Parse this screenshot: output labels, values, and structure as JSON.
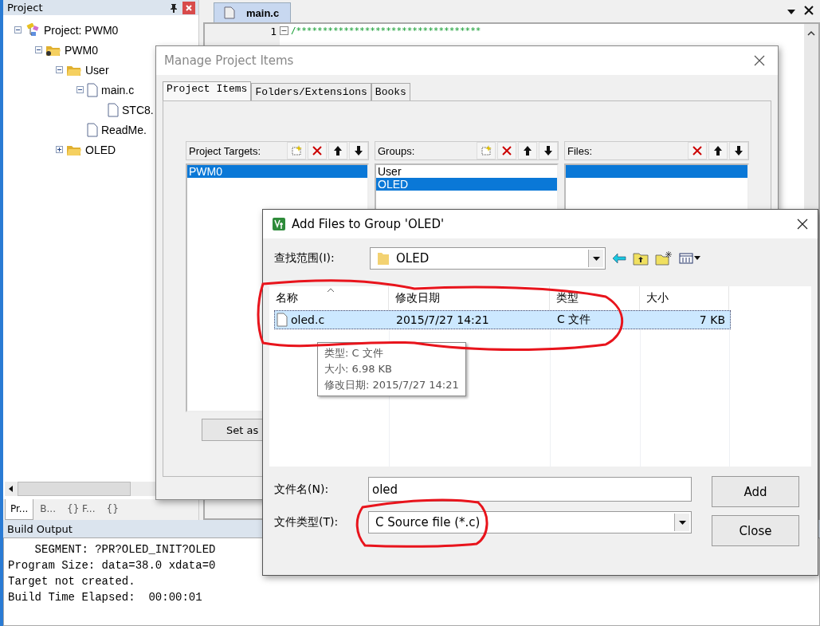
{
  "project_panel": {
    "title": "Project",
    "tree": [
      {
        "label": "Project: PWM0",
        "kind": "project",
        "expanded": true,
        "children": [
          {
            "label": "PWM0",
            "kind": "target",
            "expanded": true,
            "children": [
              {
                "label": "User",
                "kind": "folder",
                "expanded": true,
                "children": [
                  {
                    "label": "main.c",
                    "kind": "file",
                    "expanded": true,
                    "children": [
                      {
                        "label": "STC8.",
                        "kind": "file"
                      }
                    ]
                  },
                  {
                    "label": "ReadMe.",
                    "kind": "file"
                  }
                ]
              },
              {
                "label": "OLED",
                "kind": "folder",
                "expanded": false
              }
            ]
          }
        ]
      }
    ],
    "tabs": [
      {
        "label": "Pr...",
        "selected": true
      },
      {
        "label": "B...",
        "selected": false
      },
      {
        "label": "{} F...",
        "selected": false
      },
      {
        "label": "{}",
        "selected": false
      }
    ]
  },
  "editor": {
    "tab": "main.c",
    "lines": [
      {
        "number": "1",
        "text": "/***********************************"
      }
    ]
  },
  "build_output": {
    "title": "Build Output",
    "lines": [
      "    SEGMENT: ?PR?OLED_INIT?OLED",
      "Program Size: data=38.0 xdata=0",
      "Target not created.",
      "Build Time Elapsed:  00:00:01"
    ]
  },
  "manage_dialog": {
    "title": "Manage Project Items",
    "tabs": [
      {
        "label": "Project Items",
        "selected": true
      },
      {
        "label": "Folders/Extensions",
        "selected": false
      },
      {
        "label": "Books",
        "selected": false
      }
    ],
    "targets": {
      "label": "Project Targets:",
      "items": [
        {
          "label": "PWM0",
          "selected": true
        }
      ]
    },
    "groups": {
      "label": "Groups:",
      "items": [
        {
          "label": "User",
          "selected": false
        },
        {
          "label": "OLED",
          "selected": true
        }
      ]
    },
    "files": {
      "label": "Files:",
      "blank_row_selected": true
    },
    "set_button": "Set as"
  },
  "add_dialog": {
    "title": "Add Files to Group 'OLED'",
    "look_in_label": "查找范围(I):",
    "look_in_value": "OLED",
    "columns": [
      "名称",
      "修改日期",
      "类型",
      "大小"
    ],
    "rows": [
      {
        "name": "oled.c",
        "date": "2015/7/27 14:21",
        "type": "C 文件",
        "size": "7 KB",
        "selected": true
      }
    ],
    "tooltip": [
      "类型: C 文件",
      "大小: 6.98 KB",
      "修改日期: 2015/7/27 14:21"
    ],
    "filename_label": "文件名(N):",
    "filename_value": "oled",
    "filetype_label": "文件类型(T):",
    "filetype_value": "C Source file (*.c)",
    "buttons": [
      "Add",
      "Close"
    ]
  }
}
